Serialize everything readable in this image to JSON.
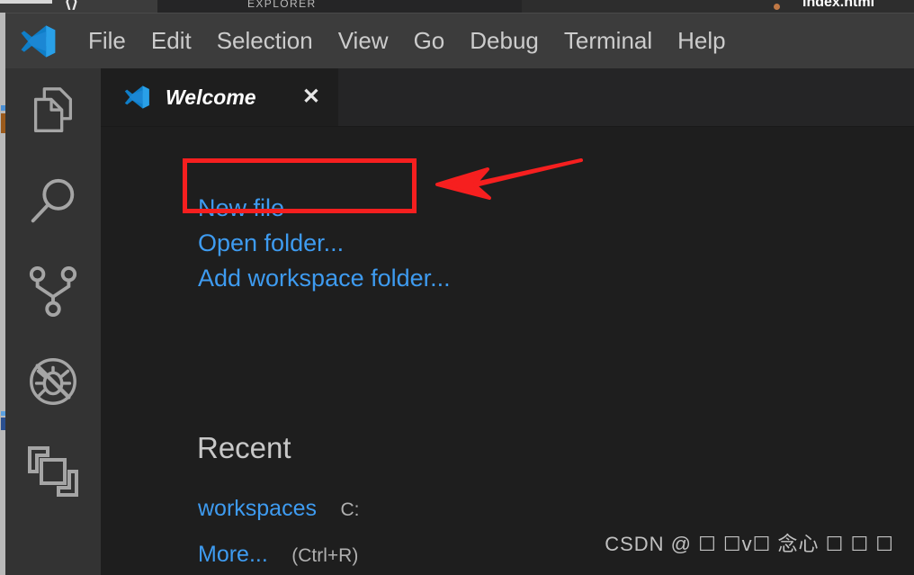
{
  "window": {
    "background_color": "#1e1e1e",
    "accent_blue": "#3e9bf0",
    "annotation_color": "#f61f1f"
  },
  "behind_window": {
    "sidebar_label": "EXPLORER",
    "tab_name": "index.html",
    "logo_glyph": "⟨⟩"
  },
  "menubar": {
    "logo_name": "vscode-logo",
    "items": [
      {
        "label": "File"
      },
      {
        "label": "Edit"
      },
      {
        "label": "Selection"
      },
      {
        "label": "View"
      },
      {
        "label": "Go"
      },
      {
        "label": "Debug"
      },
      {
        "label": "Terminal"
      },
      {
        "label": "Help"
      }
    ]
  },
  "activitybar": {
    "items": [
      {
        "name": "explorer",
        "icon": "files-icon",
        "title": "Explorer"
      },
      {
        "name": "search",
        "icon": "search-icon",
        "title": "Search"
      },
      {
        "name": "source-control",
        "icon": "source-control-icon",
        "title": "Source Control"
      },
      {
        "name": "debug",
        "icon": "debug-disabled-icon",
        "title": "Debug"
      },
      {
        "name": "extensions",
        "icon": "extensions-icon",
        "title": "Extensions"
      }
    ]
  },
  "editor": {
    "tab": {
      "title": "Welcome",
      "icon": "vscode-icon",
      "close_label": "✕"
    }
  },
  "welcome": {
    "start_links": [
      {
        "label": "New file"
      },
      {
        "label": "Open folder..."
      },
      {
        "label": "Add workspace folder..."
      }
    ],
    "recent": {
      "heading": "Recent",
      "entries": [
        {
          "name": "workspaces",
          "path": "C:"
        },
        {
          "name": "More...",
          "path": "(Ctrl+R)"
        }
      ]
    }
  },
  "watermark": {
    "text": "CSDN @ ☐ ☐v☐ 念心 ☐ ☐ ☐"
  }
}
